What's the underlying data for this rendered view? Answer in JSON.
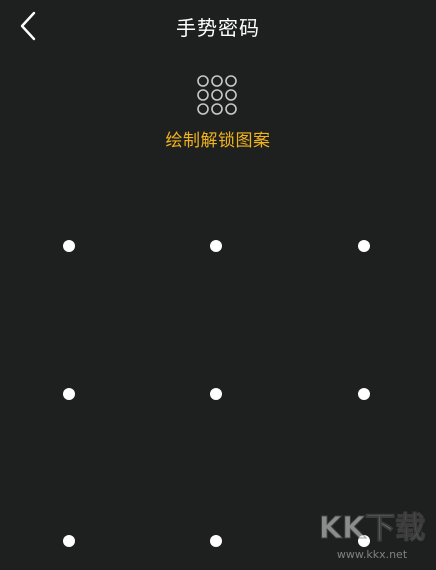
{
  "header": {
    "title": "手势密码",
    "back_icon": "chevron-left-icon"
  },
  "preview": {
    "icon": "pattern-grid-icon"
  },
  "hint": {
    "text": "绘制解锁图案",
    "color": "#f1b31c"
  },
  "pattern_pad": {
    "dot_count": 9,
    "dot_color": "#ffffff"
  },
  "watermark": {
    "text": "KK下载",
    "subtext": "www.kkx.net"
  },
  "colors": {
    "background": "#1e1f1f",
    "accent": "#f1b31c"
  }
}
